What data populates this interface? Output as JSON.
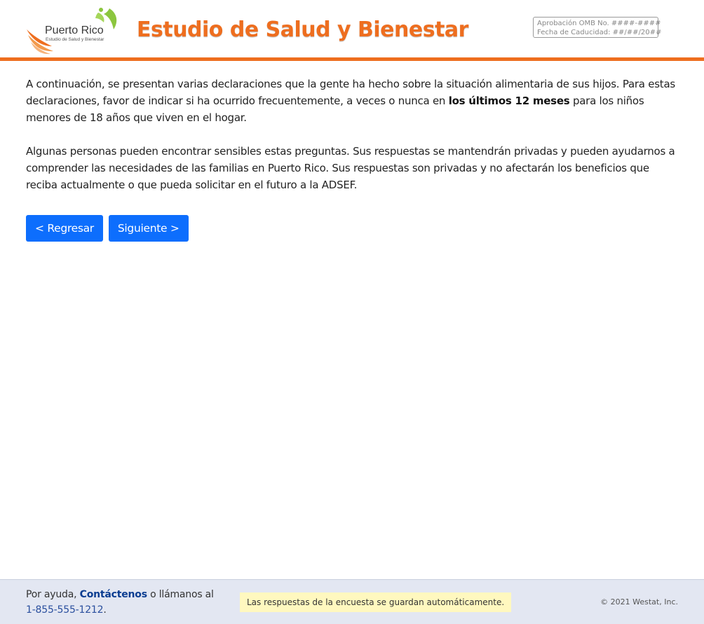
{
  "header": {
    "logo": {
      "name": "Puerto Rico",
      "tagline": "Estudio de Salud y Bienestar"
    },
    "title": "Estudio de Salud y Bienestar",
    "omb": {
      "approval": "Aprobación OMB No. ####-####",
      "expiration": "Fecha de Caducidad: ##/##/20##"
    },
    "accent_color": "#ee6e1f"
  },
  "main": {
    "intro": {
      "before": "A continuación, se presentan varias declaraciones que la gente ha hecho sobre la situación alimentaria de sus hijos. Para estas declaraciones, favor de indicar si ha ocurrido frecuentemente, a veces o nunca en ",
      "emphasis": "los últimos 12 meses",
      "after": " para los niños menores de 18 años que viven en el hogar."
    },
    "privacy": "Algunas personas pueden encontrar sensibles estas preguntas. Sus respuestas se mantendrán privadas y pueden ayudarnos a comprender las necesidades de las familias en Puerto Rico. Sus respuestas son privadas y no afectarán los beneficios que reciba actualmente o que pueda solicitar en el futuro a la ADSEF.",
    "buttons": {
      "back": "< Regresar",
      "next": "Siguiente >"
    },
    "button_color": "#0d6efd"
  },
  "footer": {
    "help_prefix": "Por ayuda, ",
    "contact_link": "Contáctenos",
    "help_middle": " o llámanos al",
    "phone": "1-855-555-1212",
    "phone_suffix": ".",
    "autosave": "Las respuestas de la encuesta se guardan automáticamente.",
    "copyright": "© 2021 Westat, Inc.",
    "background_color": "#e3e7f2"
  }
}
